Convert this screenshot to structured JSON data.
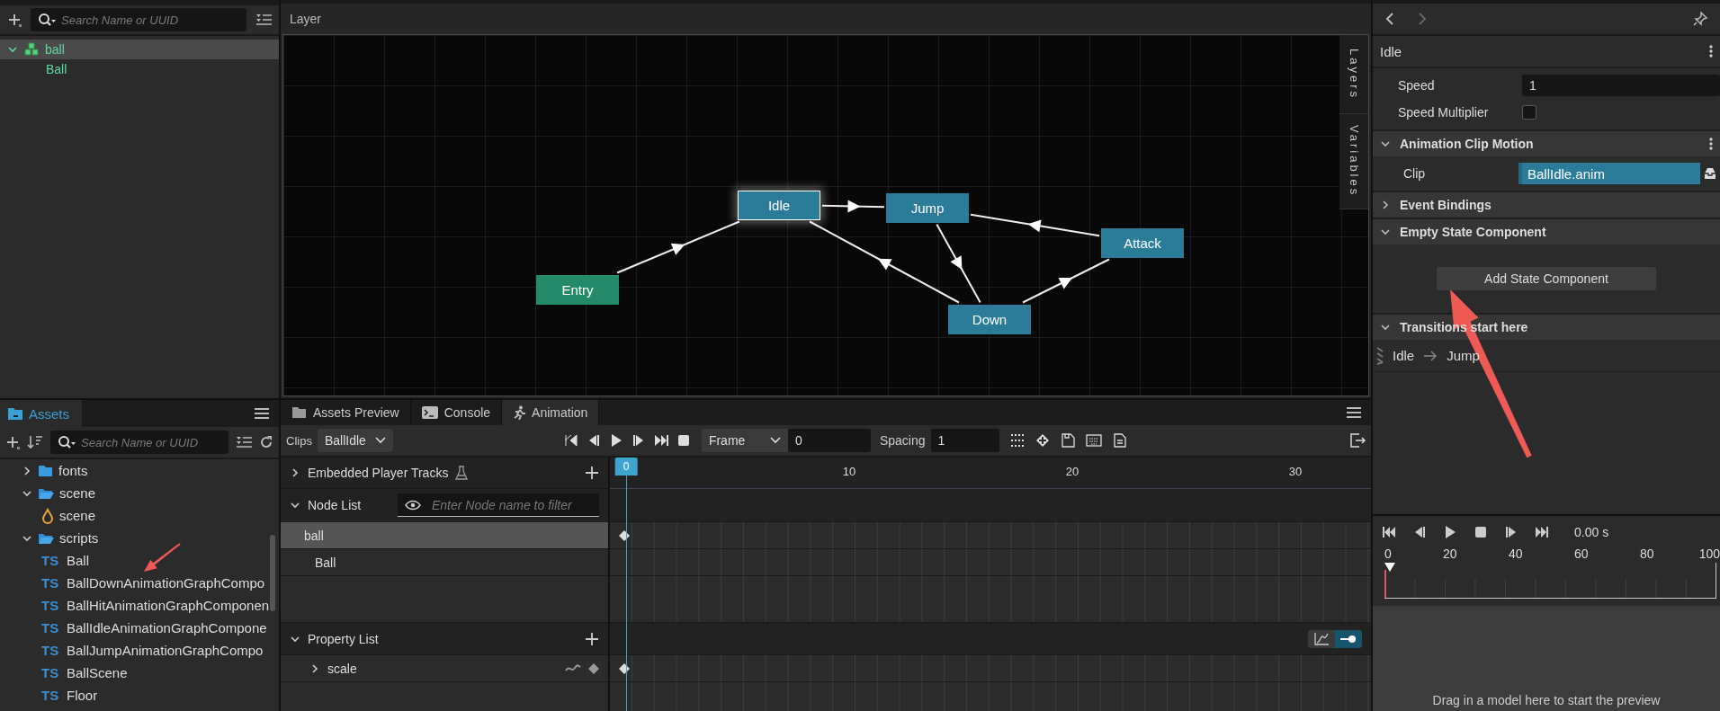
{
  "hierarchy": {
    "search_placeholder": "Search Name or UUID",
    "nodes": [
      {
        "label": "ball",
        "kind": "prefab",
        "selected": true,
        "expanded": true,
        "children": [
          {
            "label": "Ball",
            "selected": false
          }
        ]
      }
    ]
  },
  "assets": {
    "tab": "Assets",
    "search_placeholder": "Search Name or UUID",
    "items": [
      {
        "label": "fonts",
        "kind": "folder",
        "expanded": false
      },
      {
        "label": "scene",
        "kind": "folder",
        "expanded": true,
        "children": [
          {
            "label": "scene",
            "kind": "scene"
          }
        ]
      },
      {
        "label": "scripts",
        "kind": "folder",
        "expanded": true,
        "children": [
          {
            "label": "Ball",
            "kind": "script",
            "badge": "TS"
          },
          {
            "label": "BallDownAnimationGraphCompo",
            "kind": "script",
            "badge": "TS"
          },
          {
            "label": "BallHitAnimationGraphComponen",
            "kind": "script",
            "badge": "TS"
          },
          {
            "label": "BallIdleAnimationGraphCompone",
            "kind": "script",
            "badge": "TS"
          },
          {
            "label": "BallJumpAnimationGraphCompo",
            "kind": "script",
            "badge": "TS"
          },
          {
            "label": "BallScene",
            "kind": "script",
            "badge": "TS"
          },
          {
            "label": "Floor",
            "kind": "script",
            "badge": "TS"
          }
        ]
      }
    ]
  },
  "graph": {
    "title": "Layer",
    "side_tabs": [
      {
        "label": "Layers"
      },
      {
        "label": "Variables"
      }
    ],
    "states": [
      {
        "label": "Idle",
        "kind": "state",
        "selected": true
      },
      {
        "label": "Jump",
        "kind": "state",
        "selected": false
      },
      {
        "label": "Attack",
        "kind": "state",
        "selected": false
      },
      {
        "label": "Entry",
        "kind": "entry",
        "selected": false
      },
      {
        "label": "Down",
        "kind": "state",
        "selected": false
      }
    ]
  },
  "animation": {
    "tabs": [
      {
        "label": "Assets Preview",
        "kind": "folder",
        "selected": false
      },
      {
        "label": "Console",
        "kind": "console",
        "selected": false
      },
      {
        "label": "Animation",
        "kind": "runner",
        "selected": true
      }
    ],
    "clips_label": "Clips",
    "clip": "BallIdle",
    "frame_mode": "Frame",
    "frame": "0",
    "spacing_label": "Spacing",
    "spacing": "1",
    "ruler": [
      "0",
      "10",
      "20",
      "30"
    ],
    "embedded_tracks": "Embedded Player Tracks",
    "node_list": "Node List",
    "node_filter_placeholder": "Enter Node name to filter",
    "nodes": [
      {
        "label": "ball",
        "selected": true
      },
      {
        "label": "Ball",
        "selected": false
      }
    ],
    "property_list": "Property List",
    "properties": [
      {
        "label": "scale",
        "expanded": false
      }
    ],
    "view_modes": [
      {
        "kind": "curve",
        "selected": false
      },
      {
        "kind": "keys",
        "selected": true
      }
    ]
  },
  "inspector": {
    "title": "Idle",
    "fields": [
      {
        "label": "Speed",
        "kind": "number",
        "value": "1"
      },
      {
        "label": "Speed Multiplier",
        "kind": "checkbox",
        "checked": false
      }
    ],
    "sections": [
      {
        "title": "Animation Clip Motion",
        "expanded": true,
        "kind": "fields",
        "fields": [
          {
            "label": "Clip",
            "value": "BallIdle.anim"
          }
        ]
      },
      {
        "title": "Event Bindings",
        "expanded": false,
        "kind": "empty"
      },
      {
        "title": "Empty State Component",
        "expanded": true,
        "kind": "button",
        "button": "Add State Component"
      },
      {
        "title": "Transitions start here",
        "expanded": true,
        "kind": "transitions",
        "transitions": [
          {
            "from": "Idle",
            "to": "Jump"
          }
        ]
      }
    ]
  },
  "preview": {
    "time": "0.00 s",
    "ticks": [
      "0",
      "20",
      "40",
      "60",
      "80",
      "100"
    ],
    "hint": "Drag in a model here to start the preview"
  },
  "callouts": [
    {
      "kind": "arrow"
    },
    {
      "kind": "arrow"
    }
  ]
}
